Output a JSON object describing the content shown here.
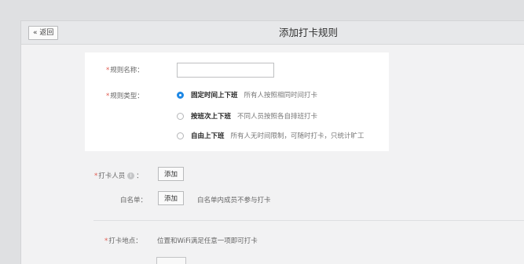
{
  "header": {
    "back_label": "« 返回",
    "title": "添加打卡规则"
  },
  "form": {
    "rule_name": {
      "required_mark": "*",
      "label": "规则名称：",
      "value": ""
    },
    "rule_type": {
      "required_mark": "*",
      "label": "规则类型：",
      "options": [
        {
          "main": "固定时间上下班",
          "desc": "所有人按照相同时间打卡",
          "checked": true
        },
        {
          "main": "按班次上下班",
          "desc": "不同人员按照各自排班打卡",
          "checked": false
        },
        {
          "main": "自由上下班",
          "desc": "所有人无时间限制，可随时打卡，只统计旷工",
          "checked": false
        }
      ]
    },
    "members": {
      "required_mark": "*",
      "label": "打卡人员",
      "info_icon": "i",
      "colon": "：",
      "add_label": "添加"
    },
    "whitelist": {
      "label": "白名单：",
      "add_label": "添加",
      "hint": "白名单内成员不参与打卡"
    },
    "location": {
      "required_mark": "*",
      "label": "打卡地点：",
      "hint": "位置和WiFi满足任意一项即可打卡"
    }
  },
  "colors": {
    "accent": "#1e88e5",
    "required": "#e05a4f"
  }
}
